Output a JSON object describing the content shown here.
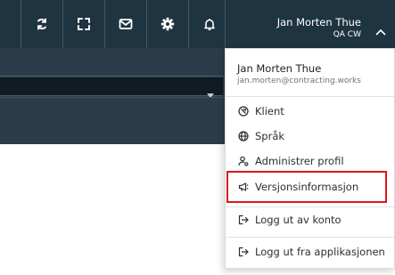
{
  "topbar": {
    "icons": [
      {
        "name": "sync-icon"
      },
      {
        "name": "fullscreen-icon"
      },
      {
        "name": "mail-icon"
      },
      {
        "name": "gear-icon"
      },
      {
        "name": "bell-icon"
      }
    ],
    "user": {
      "name": "Jan Morten Thue",
      "subtitle": "QA CW",
      "chevron": "chevron-up-icon"
    }
  },
  "dropdown": {
    "name": "Jan Morten Thue",
    "email": "jan.morten@contracting.works",
    "items": [
      {
        "label": "Klient",
        "icon": "client-icon"
      },
      {
        "label": "Språk",
        "icon": "globe-icon"
      },
      {
        "label": "Administrer profil",
        "icon": "user-gear-icon"
      },
      {
        "label": "Versjonsinformasjon",
        "icon": "megaphone-icon"
      },
      {
        "label": "Logg ut av konto",
        "icon": "logout-icon"
      },
      {
        "label": "Logg ut fra applikasjonen",
        "icon": "exit-app-icon"
      }
    ]
  },
  "colors": {
    "topbar": "#1f3441",
    "subbar": "#2b3d4a",
    "highlight": "#e0131b"
  }
}
